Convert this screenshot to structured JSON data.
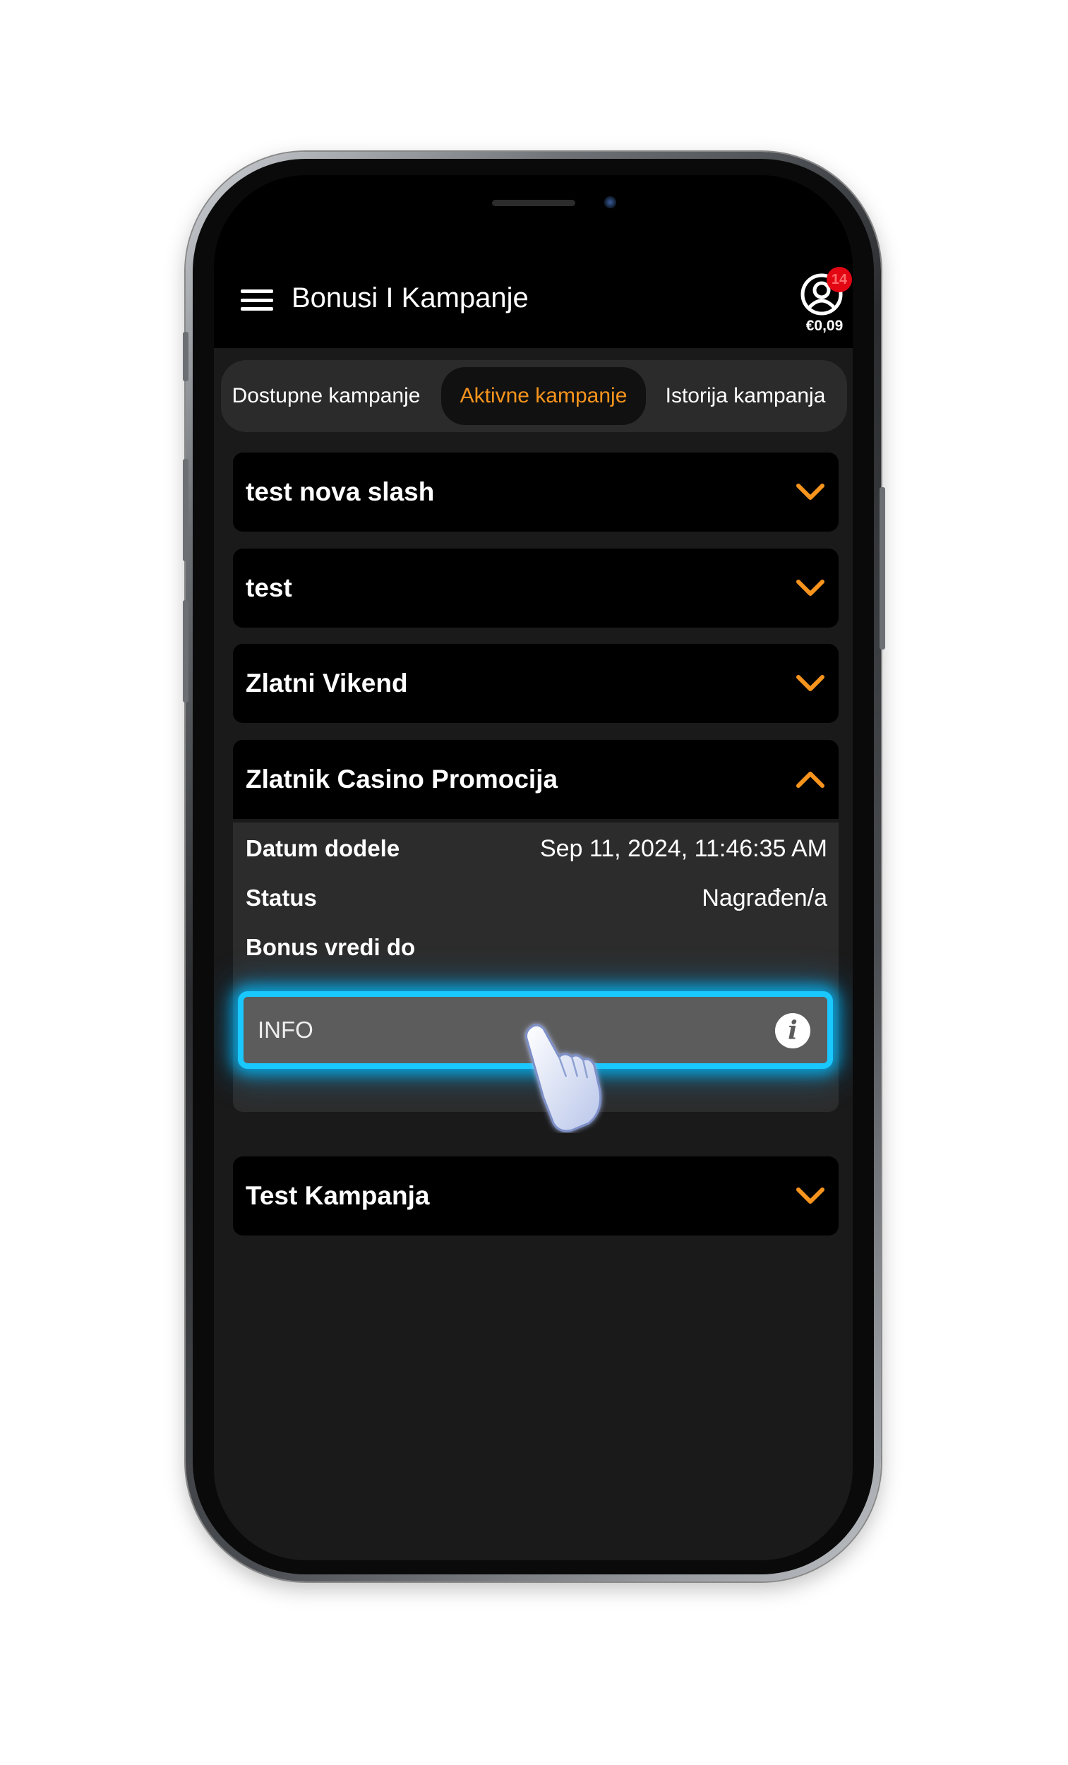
{
  "header": {
    "title": "Bonusi I Kampanje",
    "balance": "€0,09",
    "notification_count": "14"
  },
  "tabs": [
    {
      "label": "Dostupne kampanje",
      "active": false
    },
    {
      "label": "Aktivne kampanje",
      "active": true
    },
    {
      "label": "Istorija kampanja",
      "active": false
    }
  ],
  "campaigns": [
    {
      "title": "test nova slash",
      "expanded": false
    },
    {
      "title": "test",
      "expanded": false
    },
    {
      "title": "Zlatni Vikend",
      "expanded": false
    },
    {
      "title": "Zlatnik Casino Promocija",
      "expanded": true
    },
    {
      "title": "Test Kampanja",
      "expanded": false
    }
  ],
  "details": {
    "date_label": "Datum dodele",
    "date_value": "Sep 11, 2024, 11:46:35 AM",
    "status_label": "Status",
    "status_value": "Nagrađen/a",
    "valid_label": "Bonus vredi do",
    "info_label": "INFO"
  },
  "colors": {
    "accent": "#f7941d",
    "highlight": "#19c8ff",
    "badge": "#e30613"
  }
}
